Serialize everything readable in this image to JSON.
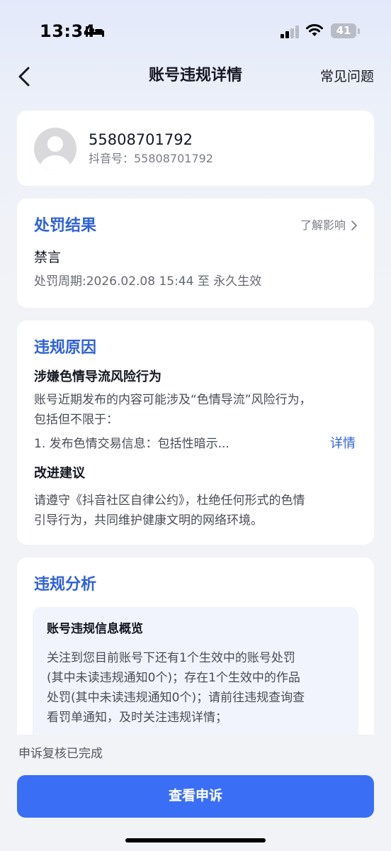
{
  "status_bar": {
    "time": "13:34",
    "battery": "41",
    "icons": [
      "bed-icon",
      "signal-icon",
      "wifi-icon",
      "battery-icon"
    ]
  },
  "nav": {
    "title": "账号违规详情",
    "faq": "常见问题",
    "back_icon": "chevron-left-icon"
  },
  "user": {
    "name": "55808701792",
    "id_line": "抖音号：55808701792"
  },
  "penalty": {
    "title": "处罚结果",
    "more": "了解影响",
    "type": "禁言",
    "period": "处罚周期:2026.02.08 15:44 至 永久生效"
  },
  "reason": {
    "title": "违规原因",
    "headline": "涉嫌色情导流风险行为",
    "desc_line1": "账号近期发布的内容可能涉及“色情导流”风险行为，",
    "desc_line2": "包括但不限于：",
    "item1": "1. 发布色情交易信息：包括性暗示...",
    "detail": "详情",
    "advice_title": "改进建议",
    "advice_line1": "请遵守《抖音社区自律公约》，杜绝任何形式的色情",
    "advice_line2": "引导行为，共同维护健康文明的网络环境。"
  },
  "analysis": {
    "title": "违规分析",
    "overview_title": "账号违规信息概览",
    "overview_line1": "关注到您目前账号下还有1个生效中的账号处罚",
    "overview_line2": "(其中未读违规通知0个)；存在1个生效中的作品",
    "overview_line3": "处罚(其中未读违规通知0个)；请前往违规查询查",
    "overview_line4": "看罚单通知，及时关注违规详情；"
  },
  "bottom": {
    "status": "申诉复核已完成",
    "button": "查看申诉"
  },
  "colors": {
    "accent_blue": "#2f62d8",
    "button_blue": "#3a6ff5"
  }
}
